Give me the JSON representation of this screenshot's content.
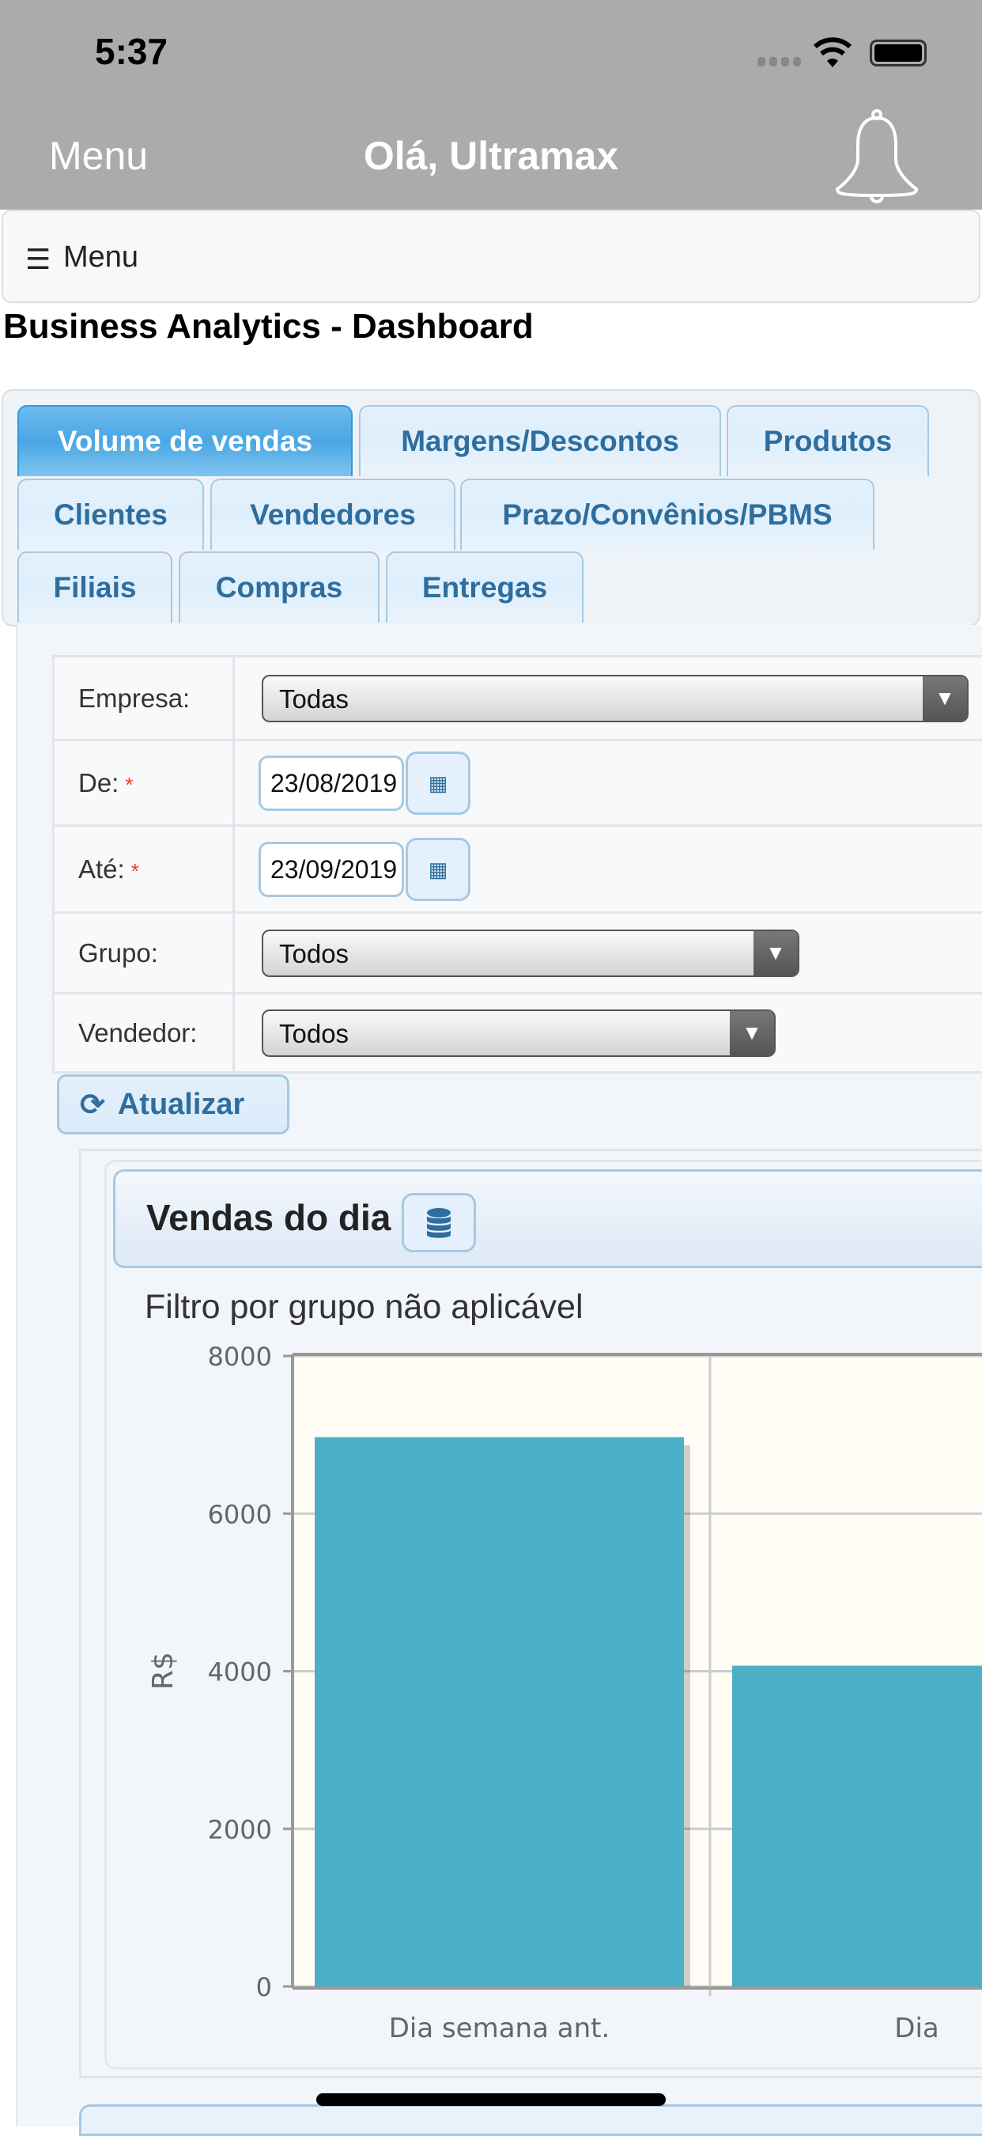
{
  "status_bar": {
    "time": "5:37"
  },
  "header": {
    "menu_label": "Menu",
    "title": "Olá, Ultramax"
  },
  "menubar": {
    "label": "Menu"
  },
  "page_title": "Business Analytics - Dashboard",
  "tabs": [
    {
      "label": "Volume de vendas",
      "active": true
    },
    {
      "label": "Margens/Descontos"
    },
    {
      "label": "Produtos"
    },
    {
      "label": "Clientes"
    },
    {
      "label": "Vendedores"
    },
    {
      "label": "Prazo/Convênios/PBMS"
    },
    {
      "label": "Filiais"
    },
    {
      "label": "Compras"
    },
    {
      "label": "Entregas"
    }
  ],
  "form": {
    "empresa": {
      "label": "Empresa:",
      "value": "Todas"
    },
    "de": {
      "label": "De:",
      "required": "*",
      "value": "23/08/2019"
    },
    "ate": {
      "label": "Até:",
      "required": "*",
      "value": "23/09/2019"
    },
    "grupo": {
      "label": "Grupo:",
      "value": "Todos"
    },
    "vendedor": {
      "label": "Vendedor:",
      "value": "Todos"
    },
    "refresh_label": "Atualizar"
  },
  "panel": {
    "title": "Vendas do dia",
    "subtitle": "Filtro por grupo não aplicável"
  },
  "chart_data": {
    "type": "bar",
    "categories": [
      "Dia semana ant.",
      "Dia"
    ],
    "values": [
      6970,
      4070
    ],
    "ylabel": "R$",
    "xlabel": "",
    "ylim": [
      0,
      8000
    ],
    "yticks": [
      "0",
      "2000",
      "4000",
      "6000",
      "8000"
    ],
    "grid": true,
    "bar_color": "#4bb0c6",
    "plot_bg": "#fffdf6"
  }
}
